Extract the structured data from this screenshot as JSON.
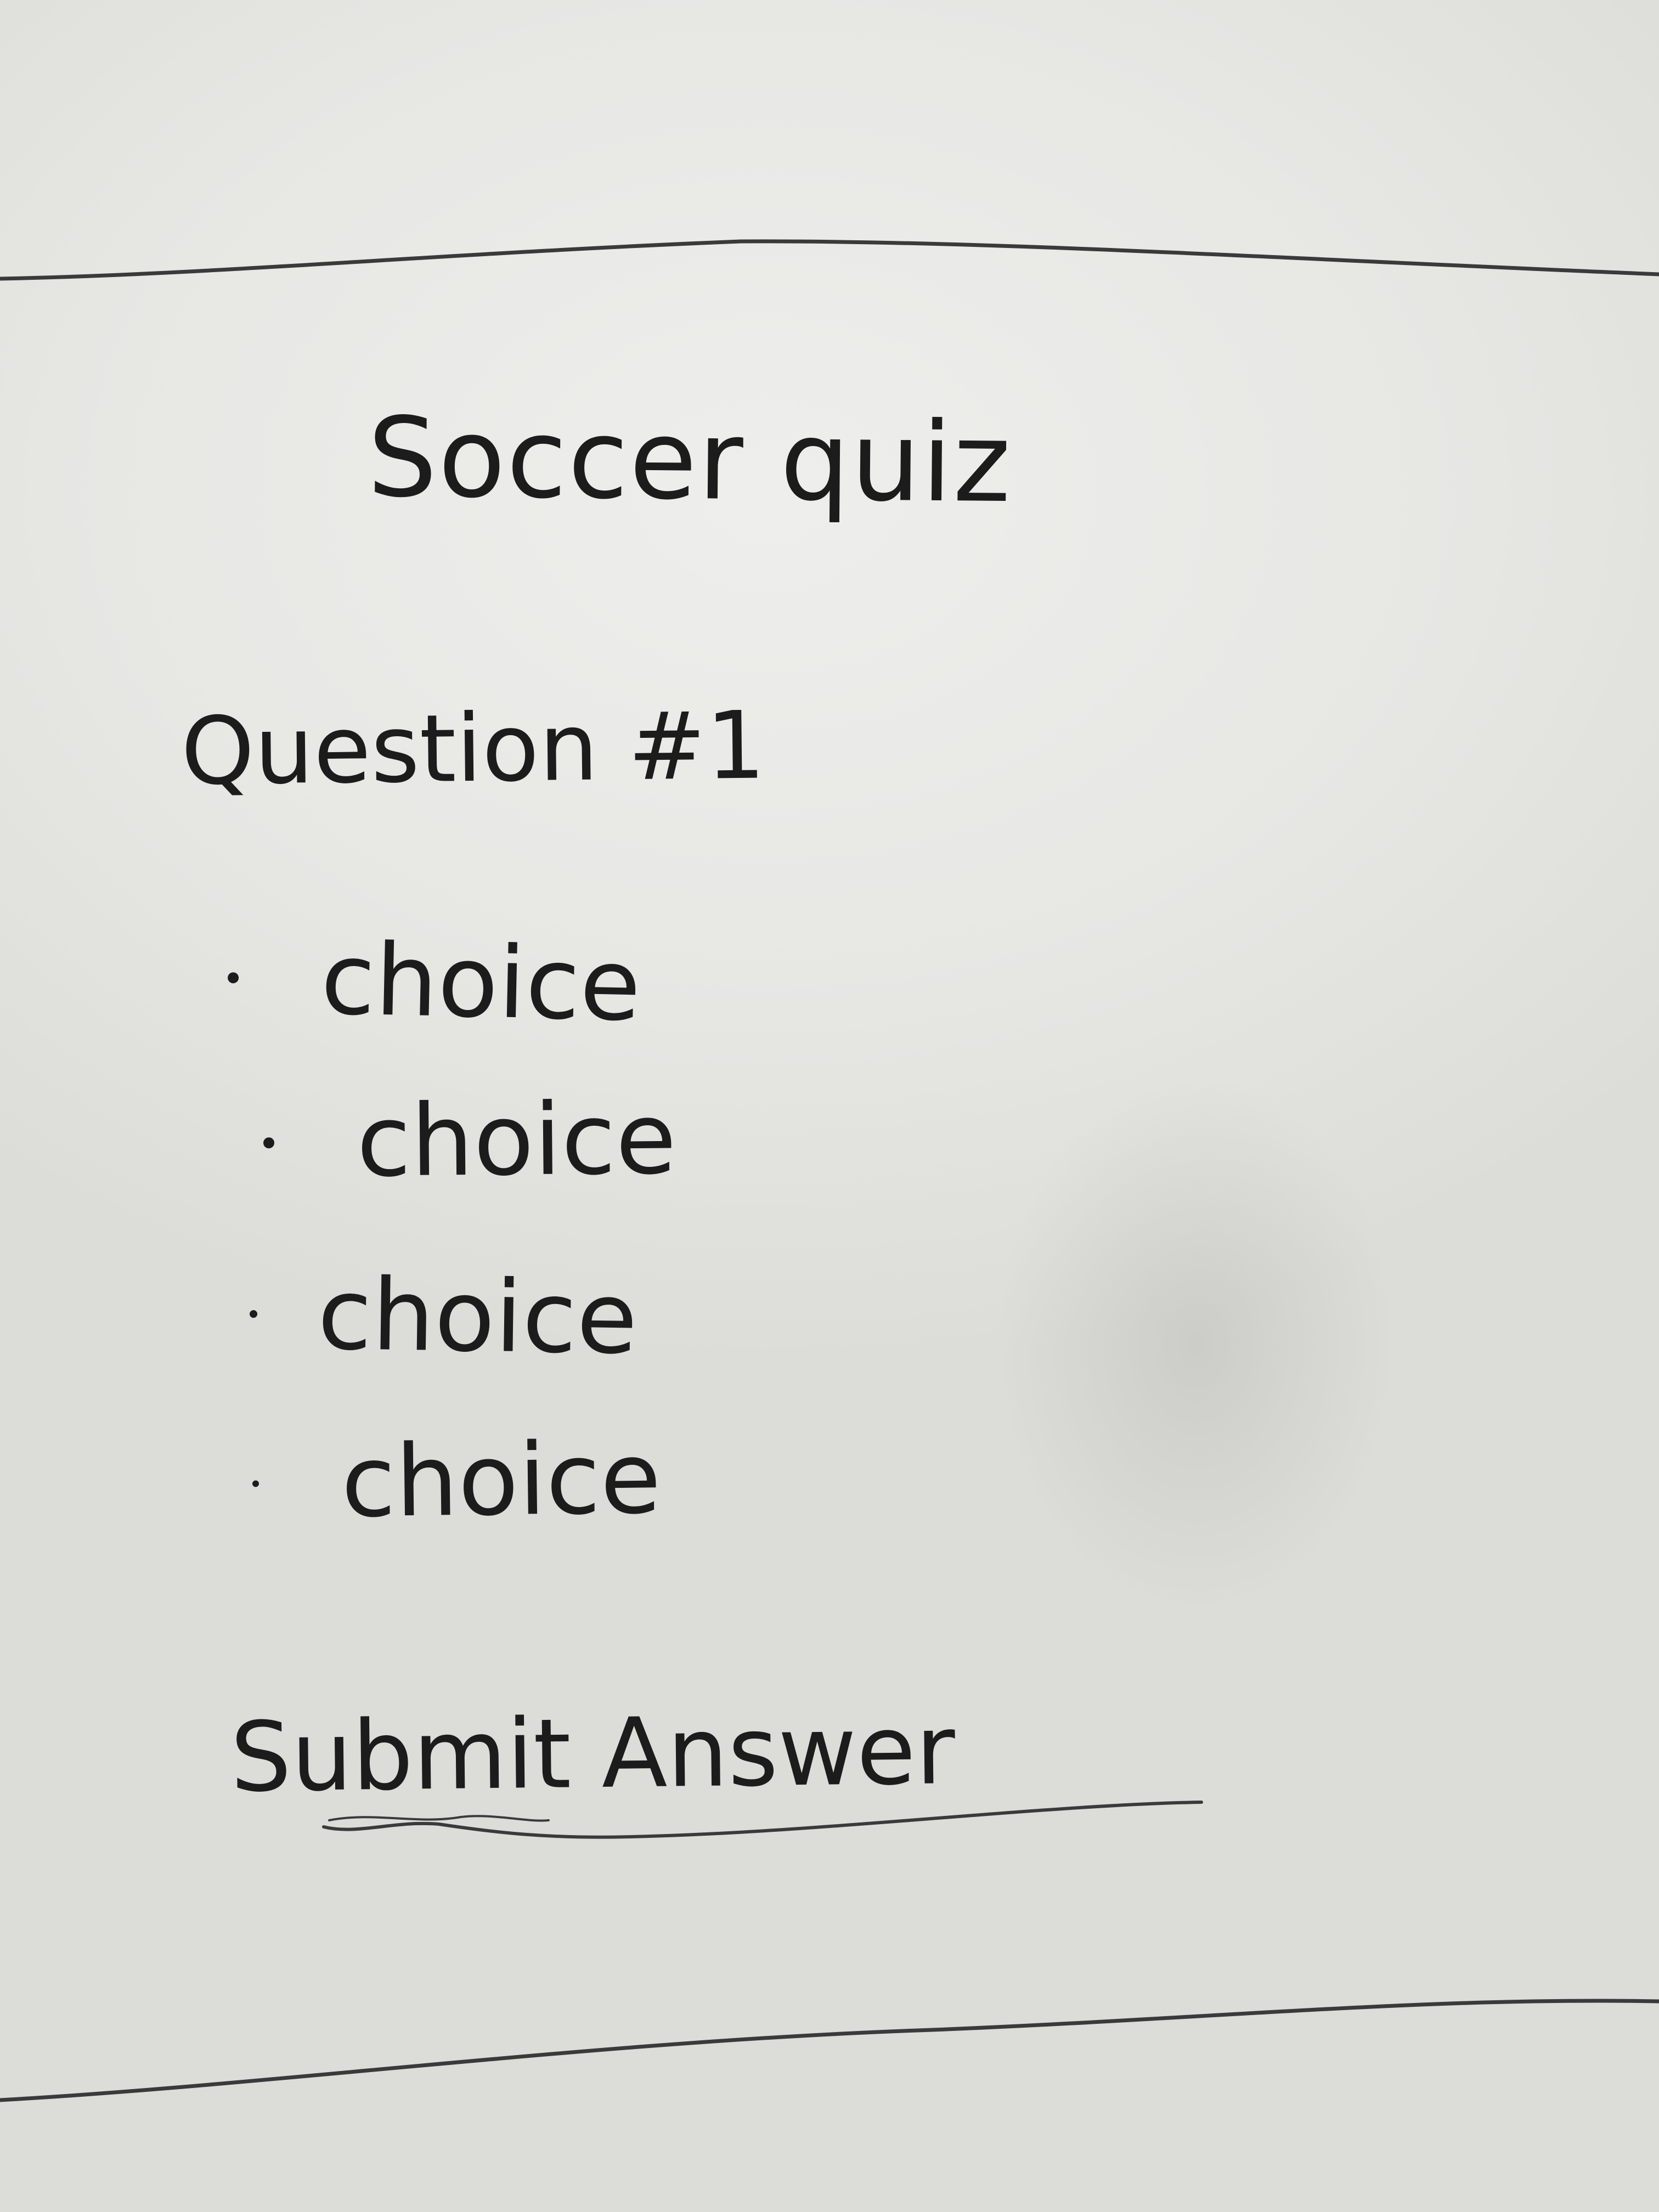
{
  "page": {
    "title": "Soccer quiz"
  },
  "question": {
    "label": "Question #1",
    "choices": [
      {
        "label": "choice"
      },
      {
        "label": "choice"
      },
      {
        "label": "choice"
      },
      {
        "label": "choice"
      }
    ]
  },
  "actions": {
    "submit_label": "Submit Answer"
  },
  "colors": {
    "ink": "#1c1c1c",
    "paper": "#e8e8e5"
  }
}
